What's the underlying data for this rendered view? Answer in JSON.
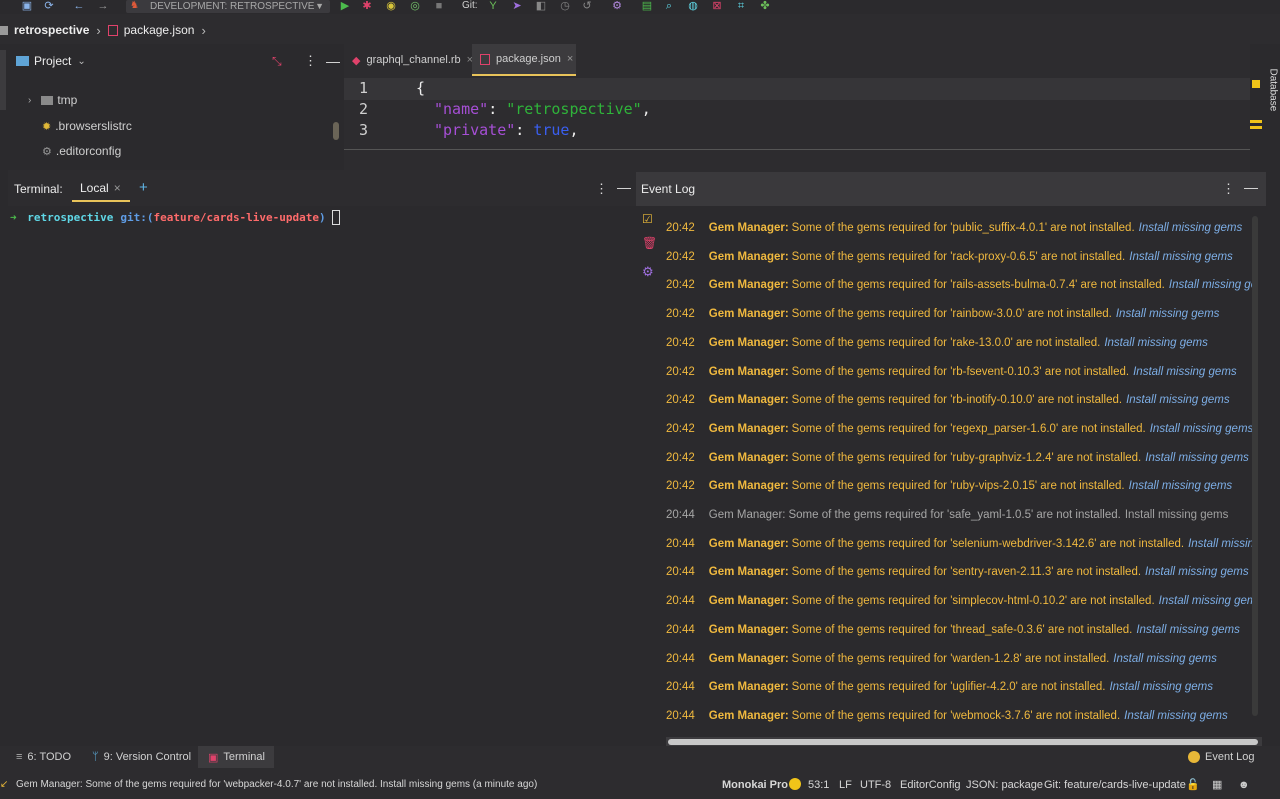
{
  "toolbar": {
    "run_config": "DEVELOPMENT: RETROSPECTIVE",
    "git_label": "Git:"
  },
  "breadcrumb": {
    "project": "retrospective",
    "file": "package.json"
  },
  "project_panel": {
    "title": "Project",
    "items": [
      {
        "label": "tmp",
        "type": "folder"
      },
      {
        "label": ".browserslistrc",
        "type": "file"
      },
      {
        "label": ".editorconfig",
        "type": "file"
      }
    ]
  },
  "editor": {
    "tabs": [
      {
        "label": "graphql_channel.rb",
        "active": false
      },
      {
        "label": "package.json",
        "active": true
      }
    ],
    "lines": [
      {
        "number": "1",
        "text": "{"
      },
      {
        "number": "2",
        "key": "\"name\"",
        "value": "\"retrospective\""
      },
      {
        "number": "3",
        "key": "\"private\"",
        "value": "true"
      }
    ]
  },
  "terminal": {
    "title": "Terminal:",
    "tab": "Local",
    "prompt_dir": "retrospective",
    "prompt_git": "git:(",
    "prompt_branch": "feature/cards-live-update",
    "prompt_close": ")"
  },
  "event_log": {
    "title": "Event Log",
    "link_text": "Install missing gems",
    "source": "Gem Manager:",
    "entries": [
      {
        "time": "20:42",
        "message": "Some of the gems required for 'public_suffix-4.0.1' are not installed.",
        "read": false
      },
      {
        "time": "20:42",
        "message": "Some of the gems required for 'rack-proxy-0.6.5' are not installed.",
        "read": false
      },
      {
        "time": "20:42",
        "message": "Some of the gems required for 'rails-assets-bulma-0.7.4' are not installed.",
        "read": false
      },
      {
        "time": "20:42",
        "message": "Some of the gems required for 'rainbow-3.0.0' are not installed.",
        "read": false
      },
      {
        "time": "20:42",
        "message": "Some of the gems required for 'rake-13.0.0' are not installed.",
        "read": false
      },
      {
        "time": "20:42",
        "message": "Some of the gems required for 'rb-fsevent-0.10.3' are not installed.",
        "read": false
      },
      {
        "time": "20:42",
        "message": "Some of the gems required for 'rb-inotify-0.10.0' are not installed.",
        "read": false
      },
      {
        "time": "20:42",
        "message": "Some of the gems required for 'regexp_parser-1.6.0' are not installed.",
        "read": false
      },
      {
        "time": "20:42",
        "message": "Some of the gems required for 'ruby-graphviz-1.2.4' are not installed.",
        "read": false
      },
      {
        "time": "20:42",
        "message": "Some of the gems required for 'ruby-vips-2.0.15' are not installed.",
        "read": false
      },
      {
        "time": "20:44",
        "message": "Some of the gems required for 'safe_yaml-1.0.5' are not installed.",
        "read": true
      },
      {
        "time": "20:44",
        "message": "Some of the gems required for 'selenium-webdriver-3.142.6' are not installed.",
        "read": false
      },
      {
        "time": "20:44",
        "message": "Some of the gems required for 'sentry-raven-2.11.3' are not installed.",
        "read": false
      },
      {
        "time": "20:44",
        "message": "Some of the gems required for 'simplecov-html-0.10.2' are not installed.",
        "read": false
      },
      {
        "time": "20:44",
        "message": "Some of the gems required for 'thread_safe-0.3.6' are not installed.",
        "read": false
      },
      {
        "time": "20:44",
        "message": "Some of the gems required for 'warden-1.2.8' are not installed.",
        "read": false
      },
      {
        "time": "20:44",
        "message": "Some of the gems required for 'uglifier-4.2.0' are not installed.",
        "read": false
      },
      {
        "time": "20:44",
        "message": "Some of the gems required for 'webmock-3.7.6' are not installed.",
        "read": false
      }
    ]
  },
  "bottom_tabs": {
    "todo": "6: TODO",
    "version_control": "9: Version Control",
    "terminal": "Terminal",
    "event_log": "Event Log"
  },
  "side_labels": {
    "database": "Database"
  },
  "status_bar": {
    "message": "Gem Manager: Some of the gems required for 'webpacker-4.0.7' are not installed. Install missing gems (a minute ago)",
    "theme": "Monokai Pro",
    "position": "53:1",
    "line_sep": "LF",
    "encoding": "UTF-8",
    "editorconfig": "EditorConfig",
    "schema": "JSON: package",
    "git": "Git: feature/cards-live-update"
  },
  "colors": {
    "accent_yellow": "#f0b93f",
    "link_blue": "#7daee6",
    "terminal_cyan": "#5fd7e6",
    "terminal_branch": "#ff6b6b"
  }
}
